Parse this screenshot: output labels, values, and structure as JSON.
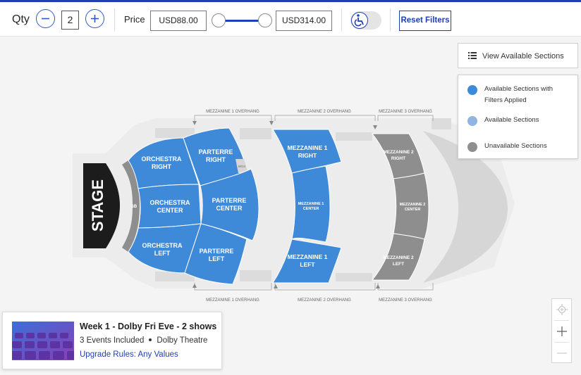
{
  "filters": {
    "qty_label": "Qty",
    "qty_value": "2",
    "price_label": "Price",
    "price_min": "USD88.00",
    "price_max": "USD314.00",
    "reset_label": "Reset Filters",
    "accessibility_toggle_on": false
  },
  "sections_panel": {
    "button_label": "View Available Sections",
    "legend": [
      {
        "label": "Available Sections with Filters Applied",
        "color": "#3f8ad8"
      },
      {
        "label": "Available Sections",
        "color": "#8fb4e2"
      },
      {
        "label": "Unavailable Sections",
        "color": "#8e8e8e"
      }
    ]
  },
  "seatmap": {
    "stage": "STAGE",
    "sb": "SB",
    "mox": "MOX",
    "sections": {
      "orchestra_right": [
        "ORCHESTRA",
        "RIGHT"
      ],
      "orchestra_center": [
        "ORCHESTRA",
        "CENTER"
      ],
      "orchestra_left": [
        "ORCHESTRA",
        "LEFT"
      ],
      "parterre_right": [
        "PARTERRE",
        "RIGHT"
      ],
      "parterre_center": [
        "PARTERRE",
        "CENTER"
      ],
      "parterre_left": [
        "PARTERRE",
        "LEFT"
      ],
      "mezzanine1_right": [
        "MEZZANINE 1",
        "RIGHT"
      ],
      "mezzanine1_center": [
        "MEZZANINE 1",
        "CENTER"
      ],
      "mezzanine1_left": [
        "MEZZANINE 1",
        "LEFT"
      ],
      "mezzanine2_right": [
        "MEZZANINE 2",
        "RIGHT"
      ],
      "mezzanine2_center": [
        "MEZZANINE 2",
        "CENTER"
      ],
      "mezzanine2_left": [
        "MEZZANINE 2",
        "LEFT"
      ]
    },
    "overhangs": {
      "m1": "MEZZANINE 1 OVERHANG",
      "m2": "MEZZANINE 2 OVERHANG",
      "m3": "MEZZANINE 3 OVERHANG"
    },
    "colors": {
      "available_filtered": "#3f8ad8",
      "unavailable": "#8e8e8e",
      "stage": "#1c1c1c"
    }
  },
  "event": {
    "title": "Week 1 - Dolby Fri Eve - 2 shows",
    "events_included": "3 Events Included",
    "venue": "Dolby Theatre",
    "upgrade_rules": "Upgrade Rules: Any Values"
  },
  "icons": {
    "qty_minus": "minus-icon",
    "qty_plus": "plus-icon",
    "accessibility": "wheelchair-icon",
    "list": "list-icon",
    "locate": "crosshair-icon",
    "zoom_in": "plus-icon",
    "zoom_out": "minus-icon"
  }
}
